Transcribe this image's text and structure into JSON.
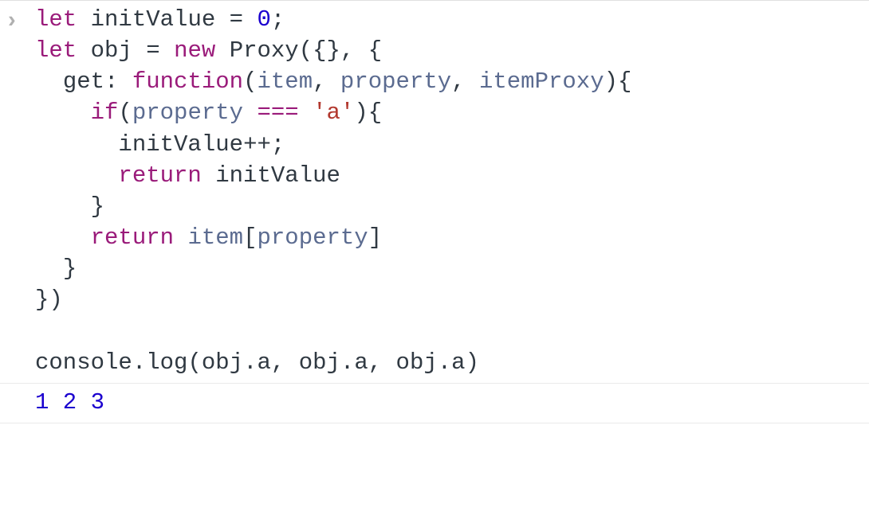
{
  "prompt_glyph": "›",
  "code": {
    "l1": {
      "let": "let",
      "sp1": " ",
      "v1": "initValue",
      "sp2": " ",
      "eq": "=",
      "sp3": " ",
      "zero": "0",
      "semi": ";"
    },
    "l2": {
      "let": "let",
      "sp1": " ",
      "v2": "obj",
      "sp2": " ",
      "eq": "=",
      "sp3": " ",
      "new": "new",
      "sp4": " ",
      "proxy": "Proxy",
      "op": "({}, {"
    },
    "l3": {
      "indent": "  ",
      "get": "get",
      "colon": ": ",
      "func": "function",
      "lp": "(",
      "p1": "item",
      "c1": ", ",
      "p2": "property",
      "c2": ", ",
      "p3": "itemProxy",
      "rp": "){"
    },
    "l4": {
      "indent": "    ",
      "if": "if",
      "lp": "(",
      "prop": "property",
      "sp1": " ",
      "eqeq": "===",
      "sp2": " ",
      "str": "'a'",
      "rp": "){"
    },
    "l5": {
      "indent": "      ",
      "iv": "initValue",
      "pp": "++;",
      "ppop": ""
    },
    "l6": {
      "indent": "      ",
      "ret": "return",
      "sp": " ",
      "iv": "initValue"
    },
    "l7": {
      "indent": "    ",
      "brace": "}"
    },
    "l8": {
      "indent": "    ",
      "ret": "return",
      "sp": " ",
      "item": "item",
      "lb": "[",
      "prop": "property",
      "rb": "]"
    },
    "l9": {
      "indent": "  ",
      "brace": "}"
    },
    "l10": {
      "text": "})"
    },
    "l11": {
      "text": ""
    },
    "l12": {
      "console": "console",
      "dot": ".",
      "log": "log",
      "lp": "(",
      "o1": "obj",
      "d1": ".",
      "a1": "a",
      "c1": ", ",
      "o2": "obj",
      "d2": ".",
      "a2": "a",
      "c2": ", ",
      "o3": "obj",
      "d3": ".",
      "a3": "a",
      "rp": ")"
    }
  },
  "output": "1 2 3"
}
